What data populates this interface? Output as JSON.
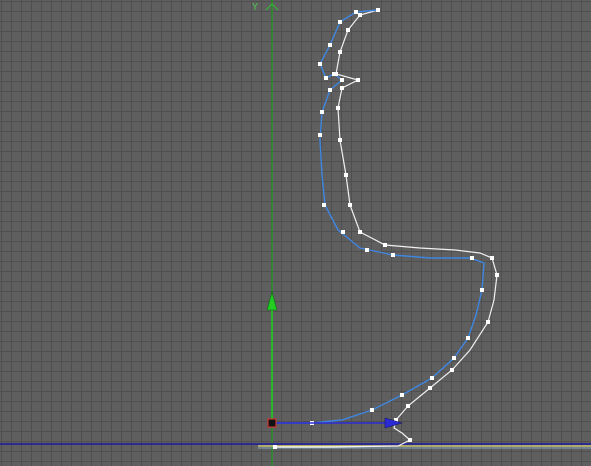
{
  "viewport": {
    "axis_y_label": "Y"
  },
  "colors": {
    "y_axis": "#1f9f1f",
    "x_axis": "#1a1aa0",
    "spline_selected": "#3f86e0",
    "spline_unselected": "#f2f2f2",
    "vertex": "#ffffff",
    "gizmo_y": "#22cc22",
    "gizmo_x": "#2b2bd6",
    "ground_line": "#e0d870"
  }
}
